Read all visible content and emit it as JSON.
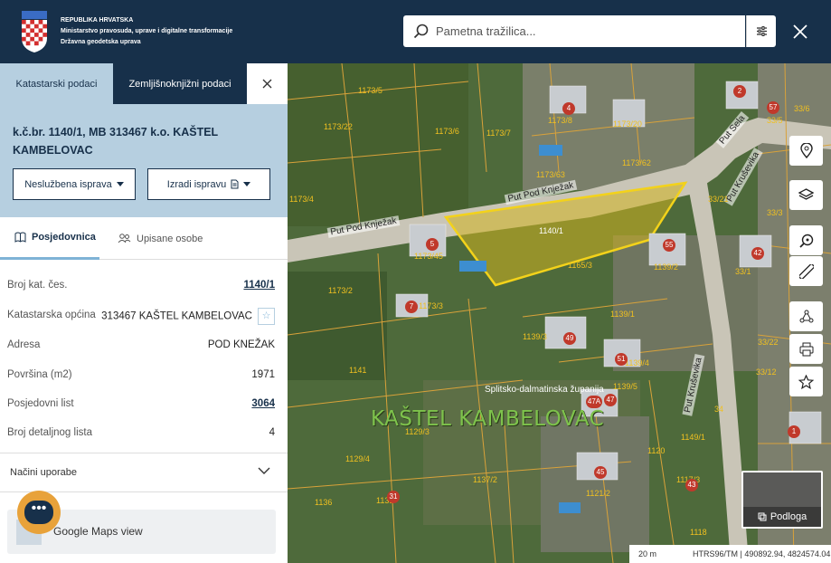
{
  "header": {
    "org_line1": "REPUBLIKA HRVATSKA",
    "org_line2": "Ministarstvo pravosuda, uprave i digitalne transformacije",
    "org_line3": "Državna geodetska uprava",
    "search_placeholder": "Pametna tražilica...",
    "brand_color": "#17304a"
  },
  "tabs": {
    "cadastral": "Katastarski podaci",
    "land_registry": "Zemljišnoknjižni podaci"
  },
  "parcel": {
    "title": "k.č.br. 1140/1, MB 313467 k.o. KAŠTEL KAMBELOVAC",
    "btn_unofficial": "Neslužbena isprava",
    "btn_create": "Izradi ispravu"
  },
  "subtabs": {
    "holding": "Posjedovnica",
    "persons": "Upisane osobe"
  },
  "details": [
    {
      "key": "Broj kat. čes.",
      "value": "1140/1",
      "link": true
    },
    {
      "key": "Katastarska općina",
      "value": "313467 KAŠTEL KAMBELOVAC",
      "link": false
    },
    {
      "key": "Adresa",
      "value": "POD KNEŽAK",
      "link": false
    },
    {
      "key": "Površina (m2)",
      "value": "1971",
      "link": false
    },
    {
      "key": "Posjedovni list",
      "value": "3064",
      "link": true
    },
    {
      "key": "Broj detaljnog lista",
      "value": "4",
      "link": false
    }
  ],
  "usage": "Načini uporabe",
  "google_maps": "Google Maps view",
  "map": {
    "place": "KAŠTEL KAMBELOVAC",
    "street1": "Put Pod Knježak",
    "street2": "Put Pod Knježak",
    "street3": "Put Kruševika",
    "street4": "Put Kruševika",
    "street5": "Put Sela",
    "county": "Splitsko-dalmatinska županija",
    "parcel_selected": "1140/1",
    "basemap_label": "Podloga",
    "scale": "20 m",
    "coords": "HTRS96/TM | 490892.94, 4824574.04",
    "parcels": [
      "1173/5",
      "1173/22",
      "1173/6",
      "1173/7",
      "1173/8",
      "1173/20",
      "1173/62",
      "1173/63",
      "1173/4",
      "1173/45",
      "1173/2",
      "1173/3",
      "1165/3",
      "1139/2",
      "1139/1",
      "1139/3",
      "1139/4",
      "1139/5",
      "1141",
      "1129/3",
      "1129/4",
      "1137/2",
      "1131",
      "1136",
      "1121/2",
      "1120",
      "1118",
      "1149/1",
      "1117/3",
      "33/3",
      "33/5",
      "33/6",
      "33/22",
      "33/12",
      "33/1",
      "33/21",
      "34"
    ],
    "house_numbers": [
      "2",
      "4",
      "57",
      "5",
      "55",
      "42",
      "7",
      "49",
      "51",
      "47",
      "47A",
      "45",
      "43",
      "31",
      "1"
    ]
  }
}
